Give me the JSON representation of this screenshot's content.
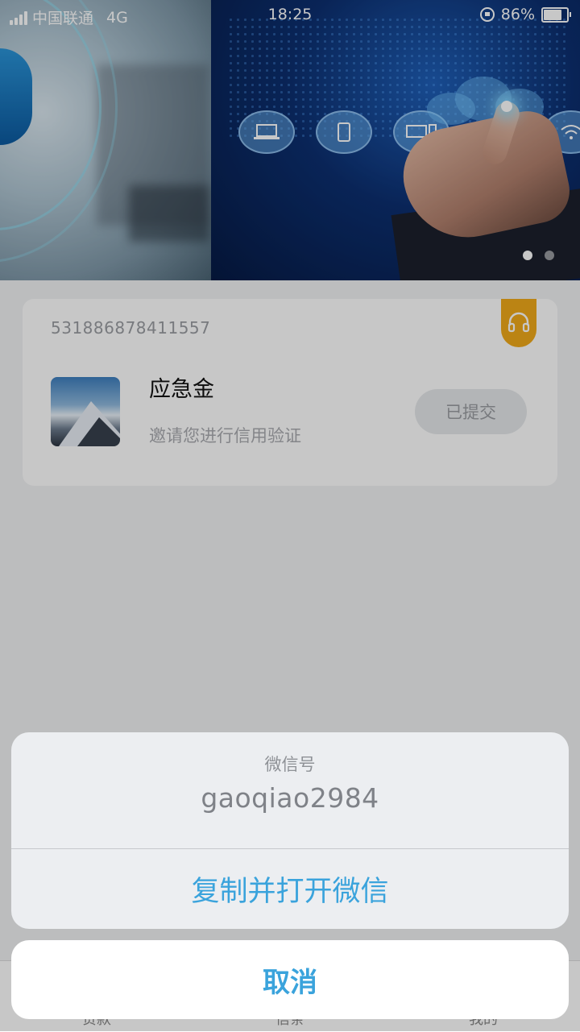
{
  "status_bar": {
    "carrier": "中国联通",
    "network": "4G",
    "time": "18:25",
    "battery": "86%",
    "battery_level": 0.86
  },
  "banner": {
    "page_count": 2,
    "active_page": 1
  },
  "card": {
    "order_number": "531886878411557",
    "product_name": "应急金",
    "product_desc": "邀请您进行信用验证",
    "status_label": "已提交",
    "service_icon": "headset-icon"
  },
  "tabbar": {
    "tabs": [
      "贷款",
      "信条",
      "我的"
    ]
  },
  "action_sheet": {
    "title": "微信号",
    "value": "gaoqiao2984",
    "action_label": "复制并打开微信",
    "cancel_label": "取消"
  },
  "colors": {
    "accent": "#3aa3dc",
    "service_tag": "#f0a91a",
    "status_button_bg": "#e6e8eb"
  }
}
